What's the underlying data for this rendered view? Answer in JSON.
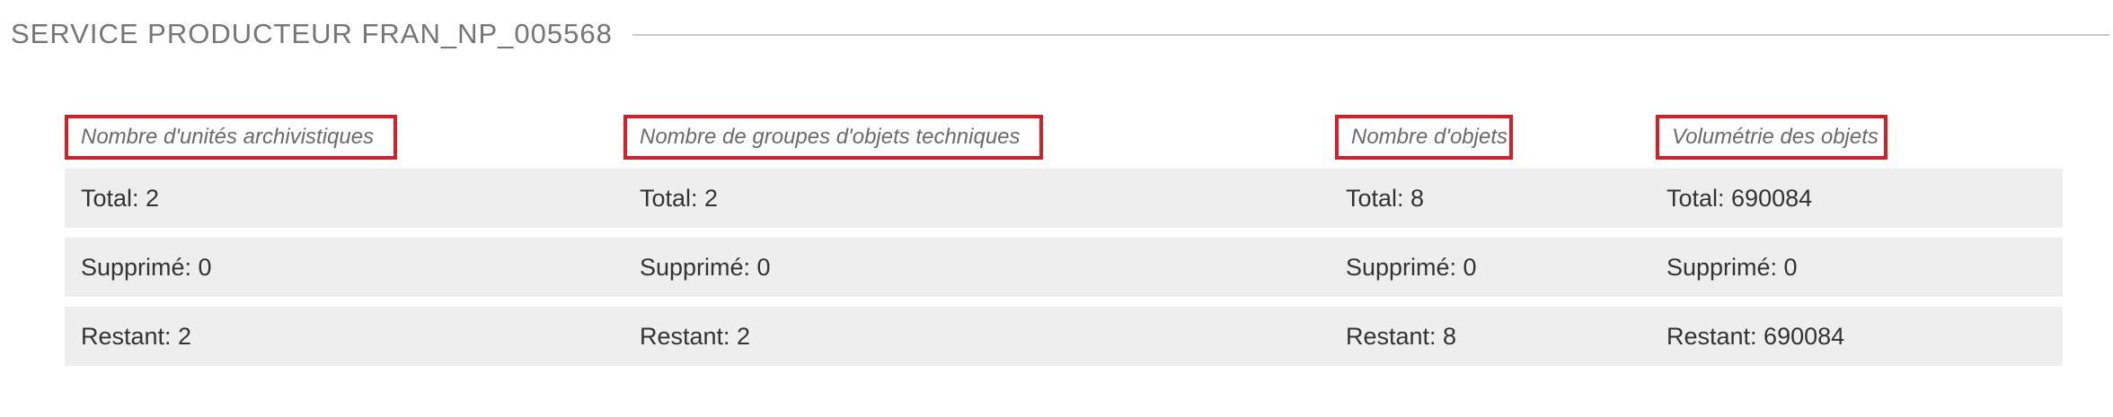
{
  "section": {
    "title": "SERVICE PRODUCTEUR FRAN_NP_005568"
  },
  "columns": [
    {
      "label": "Nombre d'unités archivistiques"
    },
    {
      "label": "Nombre de groupes d'objets techniques"
    },
    {
      "label": "Nombre d'objets"
    },
    {
      "label": "Volumétrie des objets"
    }
  ],
  "rows": [
    {
      "cells": [
        "Total: 2",
        "Total: 2",
        "Total: 8",
        "Total: 690084"
      ]
    },
    {
      "cells": [
        "Supprimé: 0",
        "Supprimé: 0",
        "Supprimé: 0",
        "Supprimé: 0"
      ]
    },
    {
      "cells": [
        "Restant: 2",
        "Restant: 2",
        "Restant: 8",
        "Restant: 690084"
      ]
    }
  ],
  "colors": {
    "highlight_border": "#d32027",
    "row_background": "#eeeeee",
    "header_text": "#757575",
    "divider": "#c8c8c8"
  }
}
